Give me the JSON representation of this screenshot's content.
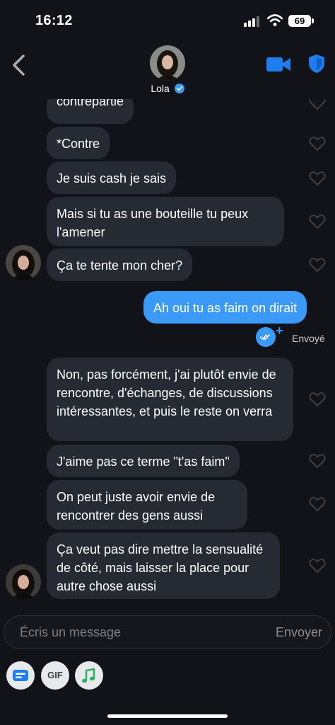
{
  "status_bar": {
    "time": "16:12",
    "battery": "69"
  },
  "header": {
    "name": "Lola",
    "verified": true
  },
  "messages": [
    {
      "id": "m1",
      "direction": "received",
      "text": "contrepartie",
      "liked": false
    },
    {
      "id": "m2",
      "direction": "received",
      "text": "*Contre",
      "liked": false
    },
    {
      "id": "m3",
      "direction": "received",
      "text": "Je suis cash je sais",
      "liked": false
    },
    {
      "id": "m4",
      "direction": "received",
      "text": "Mais si tu as une bouteille tu peux l'amener",
      "liked": false
    },
    {
      "id": "m5",
      "direction": "received",
      "text": "Ça te tente mon cher?",
      "liked": false
    },
    {
      "id": "m6",
      "direction": "sent",
      "text": "Ah oui tu as faim on dirait"
    },
    {
      "id": "m7",
      "direction": "received",
      "text": "Non, pas forcément, j'ai plutôt envie de rencontre, d'échanges, de discussions intéressantes, et puis le reste on verra",
      "liked": false
    },
    {
      "id": "m8",
      "direction": "received",
      "text": "J'aime pas ce terme \"t'as faim\"",
      "liked": false
    },
    {
      "id": "m9",
      "direction": "received",
      "text": "On peut juste avoir envie de rencontrer des gens aussi",
      "liked": false
    },
    {
      "id": "m10",
      "direction": "received",
      "text": "Ça veut pas dire mettre la sensualité de côté, mais laisser la place pour autre chose aussi",
      "liked": false
    }
  ],
  "sent_status": "Envoyé",
  "composer": {
    "placeholder": "Écris un message",
    "send_label": "Envoyer"
  },
  "toolbar": {
    "gif_label": "GIF"
  },
  "colors": {
    "background": "#111318",
    "received_bubble": "#262a33",
    "sent_bubble": "#3b9af7",
    "accent": "#1e7ef0",
    "music_icon": "#2bb35a"
  }
}
